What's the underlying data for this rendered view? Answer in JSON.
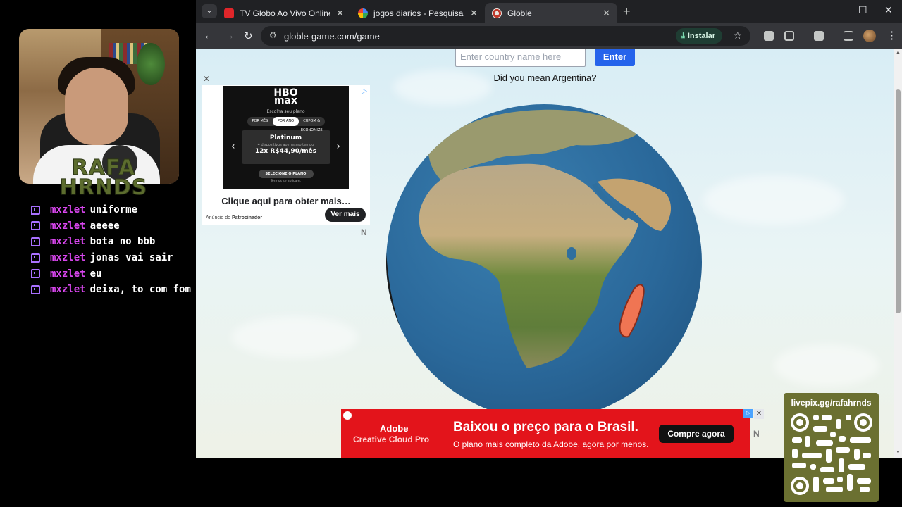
{
  "overlay": {
    "brand_line1": "RAFA",
    "brand_line2": "HRNDS",
    "chat": [
      {
        "user": "mxzlet",
        "message": "uniforme"
      },
      {
        "user": "mxzlet",
        "message": "aeeee"
      },
      {
        "user": "mxzlet",
        "message": "bota no bbb"
      },
      {
        "user": "mxzlet",
        "message": "jonas vai sair"
      },
      {
        "user": "mxzlet",
        "message": "eu"
      },
      {
        "user": "mxzlet",
        "message": "deixa, to com fom"
      }
    ],
    "qr_label": "livepix.gg/rafahrnds"
  },
  "browser": {
    "tabs": [
      {
        "title": "TV Globo Ao Vivo Online Grátis",
        "favicon_color": "#e0262a"
      },
      {
        "title": "jogos diarios - Pesquisa Google",
        "favicon_color": "#ffffff"
      },
      {
        "title": "Globle",
        "favicon_color": "#e8e4df"
      }
    ],
    "url": "globle-game.com/game",
    "install_label": "Instalar"
  },
  "game": {
    "input_placeholder": "Enter country name here",
    "enter_label": "Enter",
    "suggestion_prefix": "Did you mean ",
    "suggestion_country": "Argentina",
    "suggestion_suffix": "?",
    "guessed_country_color": "#f07553"
  },
  "ad_side": {
    "logo_line1": "HBO",
    "logo_line2": "max",
    "subtitle": "Escolha seu plano",
    "toggle_left": "POR MÊS",
    "toggle_mid": "POR ANO",
    "toggle_right": "CUPOM & ECONOMIZE",
    "plan_name": "Platinum",
    "plan_desc": "4 dispositivos ao mesmo tempo",
    "plan_price": "12x R$44,90/mês",
    "plan_cta": "SELECIONE O PLANO",
    "terms": "Termos se aplicam.",
    "headline": "Clique aqui para obter mais…",
    "footer_prefix": "Anúncio do ",
    "footer_sponsor": "Patrocinador",
    "button": "Ver mais"
  },
  "ad_banner": {
    "brand": "Adobe",
    "product": "Creative Cloud Pro",
    "headline": "Baixou o preço para o Brasil.",
    "description": "O plano mais completo da Adobe, agora por menos.",
    "cta": "Compre agora"
  }
}
